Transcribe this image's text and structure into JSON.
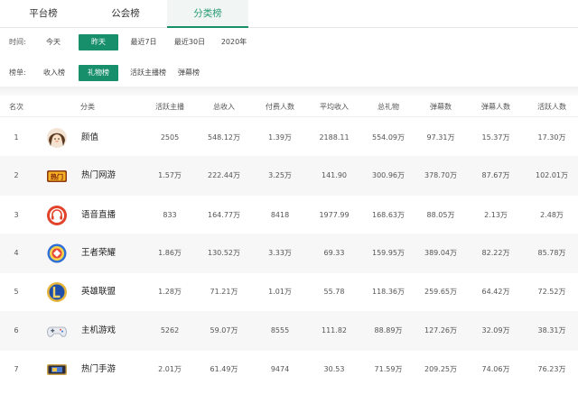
{
  "nav": {
    "tabs": [
      "平台榜",
      "公会榜",
      "分类榜"
    ],
    "active_index": 2
  },
  "filters": {
    "time": {
      "label": "时间:",
      "options": [
        "今天",
        "昨天",
        "最近7日",
        "最近30日",
        "2020年"
      ],
      "active_index": 1
    },
    "board": {
      "label": "榜单:",
      "options": [
        "收入榜",
        "礼物榜",
        "活跃主播榜",
        "弹幕榜"
      ],
      "active_index": 1
    }
  },
  "table": {
    "headers": [
      "名次",
      "分类",
      "活跃主播",
      "总收入",
      "付费人数",
      "平均收入",
      "总礼物",
      "弹幕数",
      "弹幕人数",
      "活跃人数"
    ],
    "rows": [
      {
        "rank": "1",
        "icon": "girl-avatar-icon",
        "name": "颜值",
        "values": [
          "2505",
          "548.12万",
          "1.39万",
          "2188.11",
          "554.09万",
          "97.31万",
          "15.37万",
          "17.30万"
        ]
      },
      {
        "rank": "2",
        "icon": "online-game-logo-icon",
        "name": "热门网游",
        "values": [
          "1.57万",
          "222.44万",
          "3.25万",
          "141.90",
          "300.96万",
          "378.70万",
          "87.67万",
          "102.01万"
        ]
      },
      {
        "rank": "3",
        "icon": "radio-headphones-icon",
        "name": "语音直播",
        "values": [
          "833",
          "164.77万",
          "8418",
          "1977.99",
          "168.63万",
          "88.05万",
          "2.13万",
          "2.48万"
        ]
      },
      {
        "rank": "4",
        "icon": "honor-of-kings-logo-icon",
        "name": "王者荣耀",
        "values": [
          "1.86万",
          "130.52万",
          "3.33万",
          "69.33",
          "159.95万",
          "389.04万",
          "82.22万",
          "85.78万"
        ]
      },
      {
        "rank": "5",
        "icon": "league-of-legends-logo-icon",
        "name": "英雄联盟",
        "values": [
          "1.28万",
          "71.21万",
          "1.01万",
          "55.78",
          "118.36万",
          "259.65万",
          "64.42万",
          "72.52万"
        ]
      },
      {
        "rank": "6",
        "icon": "gamepad-icon",
        "name": "主机游戏",
        "values": [
          "5262",
          "59.07万",
          "8555",
          "111.82",
          "88.89万",
          "127.26万",
          "32.09万",
          "38.31万"
        ]
      },
      {
        "rank": "7",
        "icon": "handheld-console-icon",
        "name": "热门手游",
        "values": [
          "2.01万",
          "61.49万",
          "9474",
          "30.53",
          "71.59万",
          "209.25万",
          "74.06万",
          "76.23万"
        ]
      }
    ]
  },
  "colors": {
    "accent": "#178f6b",
    "row_alt": "#f7f7f7"
  }
}
